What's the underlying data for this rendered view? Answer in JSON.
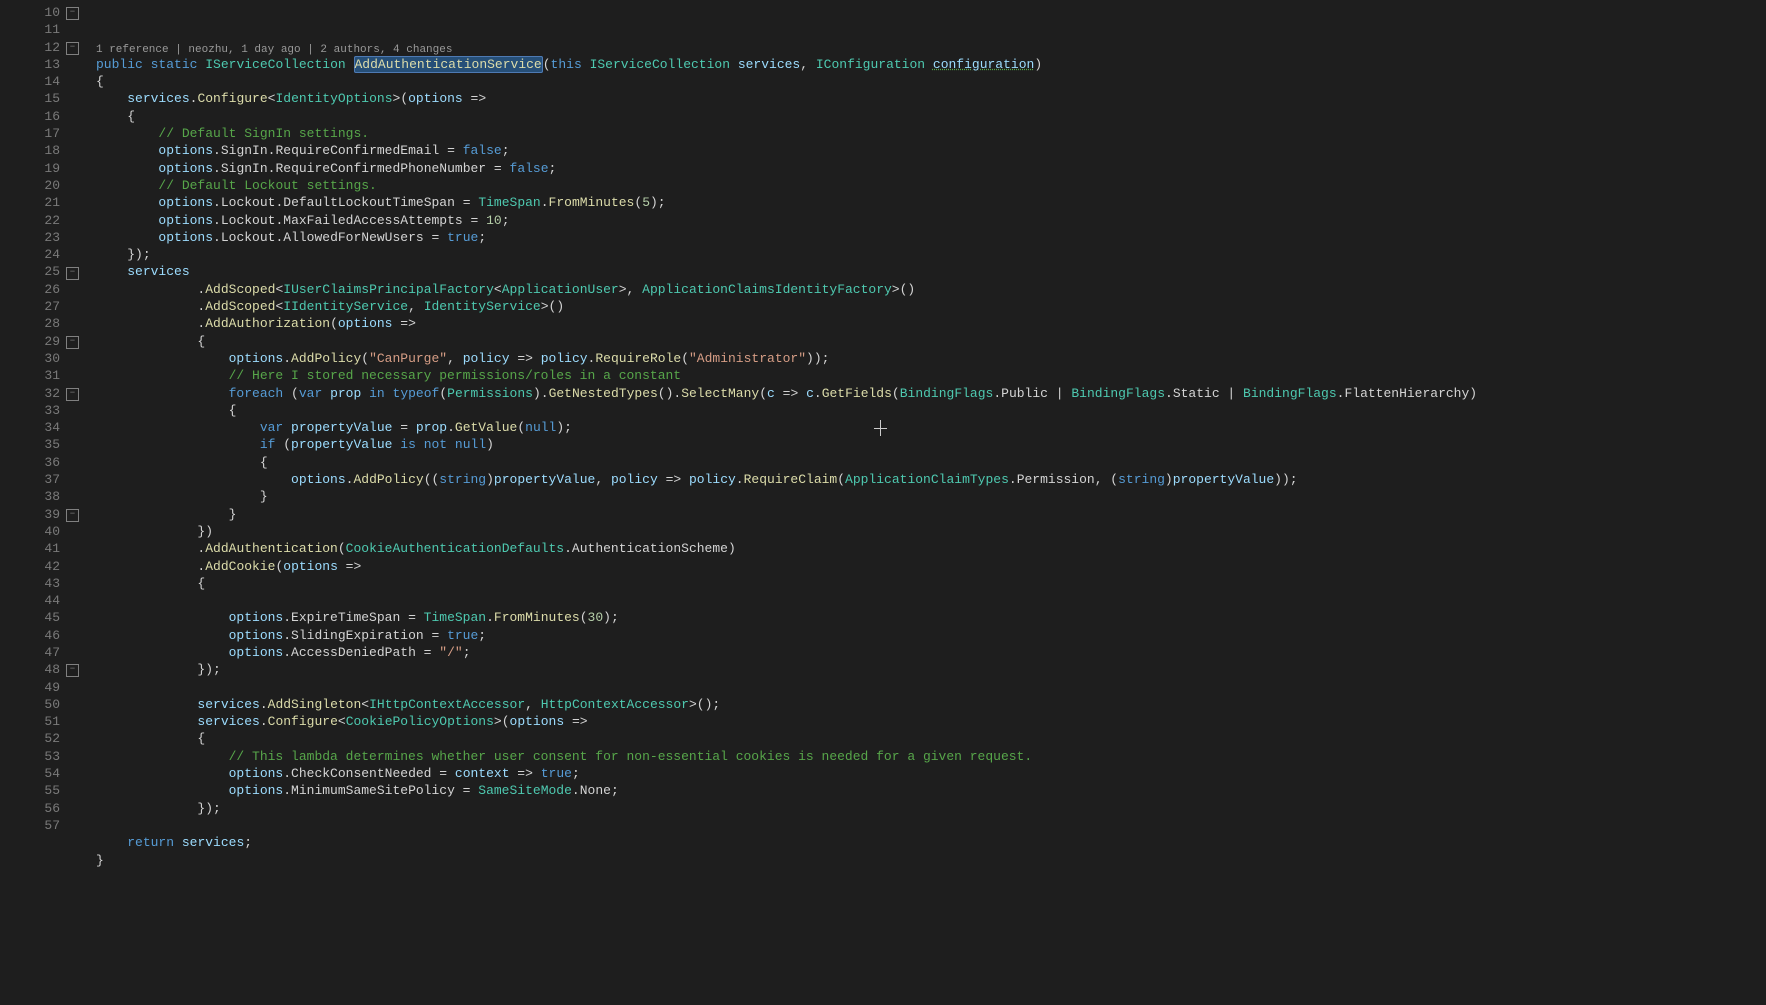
{
  "codelens": "1 reference | neozhu, 1 day ago | 2 authors, 4 changes",
  "line_numbers": [
    "10",
    "11",
    "12",
    "13",
    "14",
    "15",
    "16",
    "17",
    "18",
    "19",
    "20",
    "21",
    "22",
    "23",
    "24",
    "25",
    "26",
    "27",
    "28",
    "29",
    "30",
    "31",
    "32",
    "33",
    "34",
    "35",
    "36",
    "37",
    "38",
    "39",
    "40",
    "41",
    "42",
    "43",
    "44",
    "45",
    "46",
    "47",
    "48",
    "49",
    "50",
    "51",
    "52",
    "53",
    "54",
    "55",
    "56",
    "57"
  ],
  "folds": [
    {
      "line": 10,
      "glyph": "−"
    },
    {
      "line": 12,
      "glyph": "−"
    },
    {
      "line": 25,
      "glyph": "−"
    },
    {
      "line": 29,
      "glyph": "−"
    },
    {
      "line": 32,
      "glyph": "−"
    },
    {
      "line": 39,
      "glyph": "−"
    },
    {
      "line": 48,
      "glyph": "−"
    }
  ],
  "tokens": {
    "kw_public": "public",
    "kw_static": "static",
    "kw_this": "this",
    "kw_false": "false",
    "kw_true": "true",
    "kw_var": "var",
    "kw_foreach": "foreach",
    "kw_in": "in",
    "kw_typeof": "typeof",
    "kw_if": "if",
    "kw_is": "is",
    "kw_not": "not",
    "kw_null": "null",
    "kw_return": "return",
    "kw_string": "string",
    "t_ISC": "IServiceCollection",
    "t_IConfig": "IConfiguration",
    "t_IdentityOptions": "IdentityOptions",
    "t_IUserClaimsPrincipalFactory": "IUserClaimsPrincipalFactory",
    "t_AppUser": "ApplicationUser",
    "t_AppClaimsIdentityFactory": "ApplicationClaimsIdentityFactory",
    "t_IIdentityService": "IIdentityService",
    "t_IdentityService": "IdentityService",
    "t_Permissions": "Permissions",
    "t_BindingFlags": "BindingFlags",
    "t_AppClaimTypes": "ApplicationClaimTypes",
    "t_CookieAuthDefaults": "CookieAuthenticationDefaults",
    "t_IHttpCtxAccessor": "IHttpContextAccessor",
    "t_HttpCtxAccessor": "HttpContextAccessor",
    "t_CookiePolicyOptions": "CookiePolicyOptions",
    "t_TimeSpan": "TimeSpan",
    "t_SameSiteMode": "SameSiteMode",
    "m_AddAuthService": "AddAuthenticationService",
    "m_Configure": "Configure",
    "m_AddScoped": "AddScoped",
    "m_AddAuthorization": "AddAuthorization",
    "m_AddPolicy": "AddPolicy",
    "m_RequireRole": "RequireRole",
    "m_GetNestedTypes": "GetNestedTypes",
    "m_SelectMany": "SelectMany",
    "m_GetFields": "GetFields",
    "m_GetValue": "GetValue",
    "m_RequireClaim": "RequireClaim",
    "m_AddAuthentication": "AddAuthentication",
    "m_AddCookie": "AddCookie",
    "m_AddSingleton": "AddSingleton",
    "m_FromMinutes": "FromMinutes",
    "id_services": "services",
    "id_configuration": "configuration",
    "id_options": "options",
    "id_policy": "policy",
    "id_prop": "prop",
    "id_c": "c",
    "id_propertyValue": "propertyValue",
    "id_context": "context",
    "p_SignIn": "SignIn",
    "p_RequireConfirmedEmail": "RequireConfirmedEmail",
    "p_RequireConfirmedPhoneNumber": "RequireConfirmedPhoneNumber",
    "p_Lockout": "Lockout",
    "p_DefaultLockoutTimeSpan": "DefaultLockoutTimeSpan",
    "p_MaxFailedAccessAttempts": "MaxFailedAccessAttempts",
    "p_AllowedForNewUsers": "AllowedForNewUsers",
    "p_Public": "Public",
    "p_Static": "Static",
    "p_FlattenHierarchy": "FlattenHierarchy",
    "p_Permission": "Permission",
    "p_AuthScheme": "AuthenticationScheme",
    "p_ExpireTimeSpan": "ExpireTimeSpan",
    "p_SlidingExpiration": "SlidingExpiration",
    "p_AccessDeniedPath": "AccessDeniedPath",
    "p_CheckConsentNeeded": "CheckConsentNeeded",
    "p_MinimumSameSitePolicy": "MinimumSameSitePolicy",
    "p_None": "None",
    "s_CanPurge": "\"CanPurge\"",
    "s_Admin": "\"Administrator\"",
    "s_slash": "\"/\"",
    "n_5": "5",
    "n_10": "10",
    "n_30": "30",
    "c_signin": "// Default SignIn settings.",
    "c_lockout": "// Default Lockout settings.",
    "c_perm": "// Here I stored necessary permissions/roles in a constant",
    "c_lambda": "// This lambda determines whether user consent for non-essential cookies is needed for a given request."
  }
}
